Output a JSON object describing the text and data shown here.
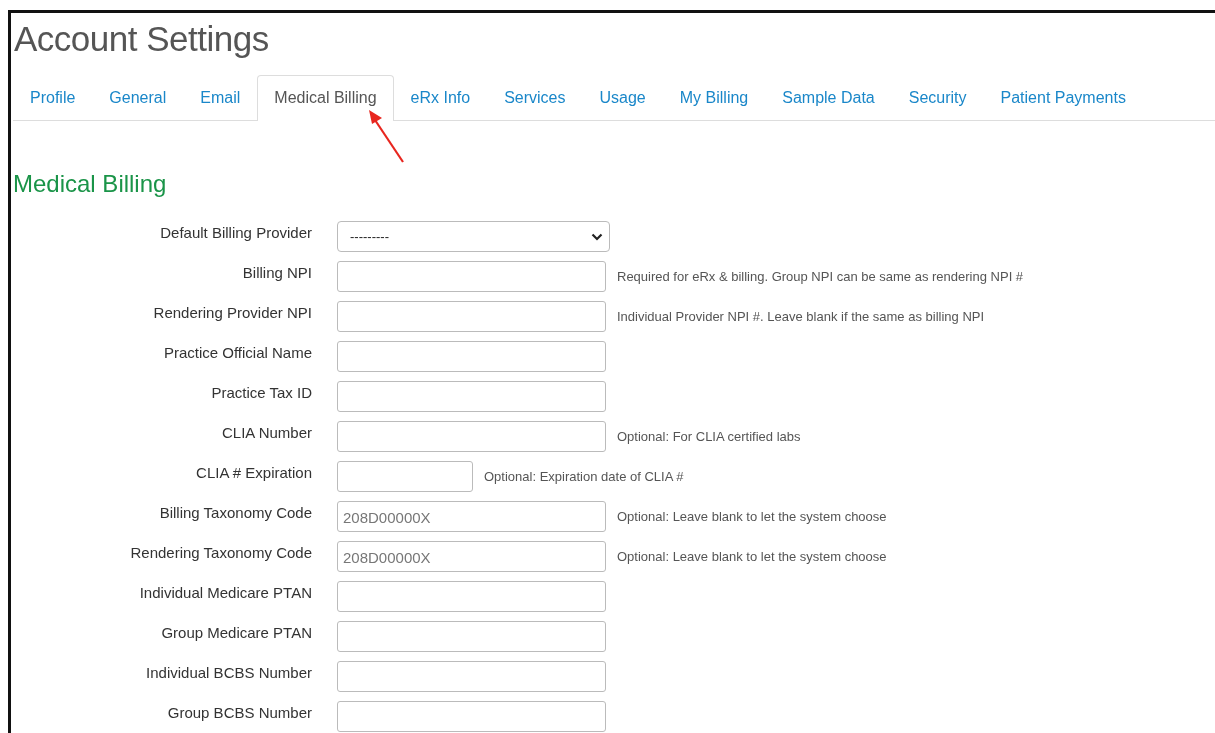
{
  "page": {
    "title": "Account Settings"
  },
  "tabs": [
    {
      "label": "Profile",
      "selected": false
    },
    {
      "label": "General",
      "selected": false
    },
    {
      "label": "Email",
      "selected": false
    },
    {
      "label": "Medical Billing",
      "selected": true
    },
    {
      "label": "eRx Info",
      "selected": false
    },
    {
      "label": "Services",
      "selected": false
    },
    {
      "label": "Usage",
      "selected": false
    },
    {
      "label": "My Billing",
      "selected": false
    },
    {
      "label": "Sample Data",
      "selected": false
    },
    {
      "label": "Security",
      "selected": false
    },
    {
      "label": "Patient Payments",
      "selected": false
    }
  ],
  "section": {
    "heading": "Medical Billing"
  },
  "fields": [
    {
      "kind": "select",
      "label": "Default Billing Provider",
      "value": "---------"
    },
    {
      "kind": "text",
      "label": "Billing NPI",
      "hint": "Required for eRx & billing. Group NPI can be same as rendering NPI #"
    },
    {
      "kind": "text",
      "label": "Rendering Provider NPI",
      "hint": "Individual Provider NPI #. Leave blank if the same as billing NPI"
    },
    {
      "kind": "text",
      "label": "Practice Official Name"
    },
    {
      "kind": "text",
      "label": "Practice Tax ID"
    },
    {
      "kind": "text",
      "label": "CLIA Number",
      "hint": "Optional: For CLIA certified labs"
    },
    {
      "kind": "date",
      "label": "CLIA # Expiration",
      "hint": "Optional: Expiration date of CLIA #"
    },
    {
      "kind": "text",
      "label": "Billing Taxonomy Code",
      "placeholder": "208D00000X",
      "hint": "Optional: Leave blank to let the system choose"
    },
    {
      "kind": "text",
      "label": "Rendering Taxonomy Code",
      "placeholder": "208D00000X",
      "hint": "Optional: Leave blank to let the system choose"
    },
    {
      "kind": "text",
      "label": "Individual Medicare PTAN"
    },
    {
      "kind": "text",
      "label": "Group Medicare PTAN"
    },
    {
      "kind": "text",
      "label": "Individual BCBS Number"
    },
    {
      "kind": "text",
      "label": "Group BCBS Number"
    }
  ]
}
